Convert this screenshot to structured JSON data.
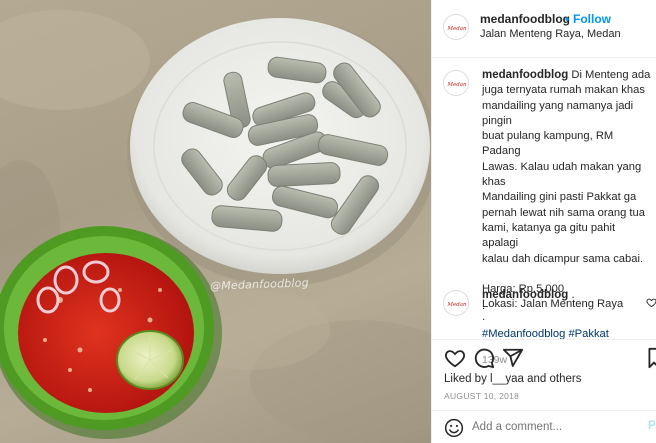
{
  "post": {
    "author": "medanfoodblog",
    "follow_label": "Follow",
    "separator": "•",
    "location": "Jalan Menteng Raya, Medan",
    "avatar_text": "Medanfoodblog",
    "photo_watermark": "@Medanfoodblog",
    "caption": {
      "username": "medanfoodblog",
      "lines": [
        "Di Menteng ada",
        "juga ternyata rumah makan khas",
        "mandailing yang namanya jadi pingin",
        "buat pulang kampung, RM Padang",
        "Lawas. Kalau udah makan yang khas",
        "Mandailing gini pasti Pakkat ga",
        "pernah lewat nih sama orang tua",
        "kami, katanya ga gitu pahit apalagi",
        "kalau dah dicampur sama cabai."
      ],
      "price": "Harga: Rp.5.000",
      "address": "Lokasi: Jalan Menteng Raya",
      "hashtags": "#Medanfoodblog #Pakkat",
      "age": "139w"
    },
    "comment": {
      "username": "medanfoodblog",
      "lines": [
        ".",
        ".",
        "."
      ]
    },
    "likes_text": "Liked by l__yaa and others",
    "date": "AUGUST 10, 2018",
    "add_comment_placeholder": "Add a comment...",
    "post_button": "P"
  },
  "icons": [
    "heart-icon",
    "comment-icon",
    "share-icon",
    "bookmark-icon",
    "emoji-icon",
    "comment-like-icon"
  ],
  "colors": {
    "accent": "#0095f6",
    "hashtag": "#00376b",
    "plate_green": "#5aa52a",
    "sambal": "#d8231c"
  }
}
